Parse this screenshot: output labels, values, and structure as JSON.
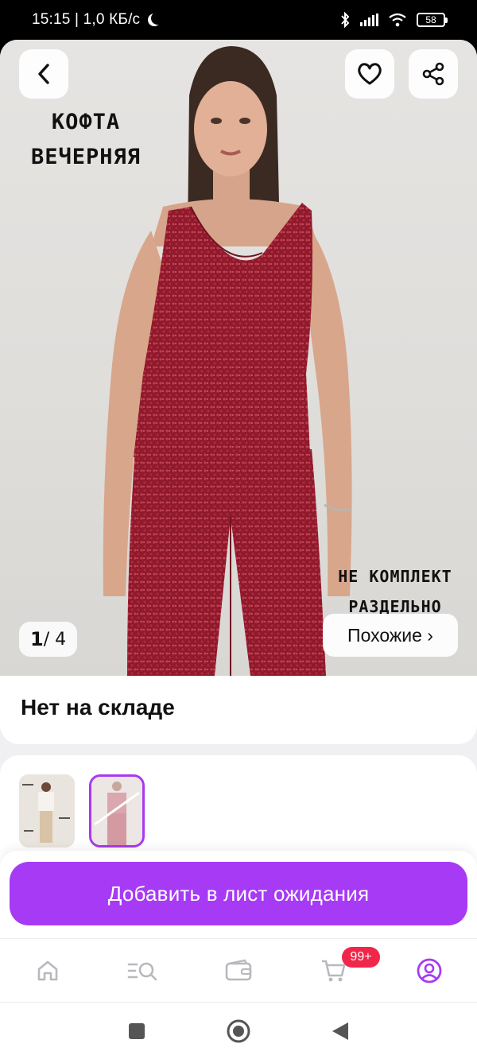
{
  "status_bar": {
    "time": "15:15",
    "speed": "| 1,0 КБ/с",
    "battery": "58"
  },
  "product": {
    "overlay_title_line1": "КОФТА",
    "overlay_title_line2": "ВЕЧЕРНЯЯ",
    "overlay_note_line1": "НЕ КОМПЛЕКТ",
    "overlay_note_line2": "РАЗДЕЛЬНО",
    "image_counter_current": "1",
    "image_counter_total": "/ 4",
    "similar_label": "Похожие ›",
    "stock_status": "Нет на складе"
  },
  "cta": {
    "label": "Добавить в лист ожидания",
    "color": "#a73af5"
  },
  "tabbar": {
    "items": [
      {
        "icon": "home-icon"
      },
      {
        "icon": "catalog-search-icon"
      },
      {
        "icon": "wallet-icon"
      },
      {
        "icon": "cart-icon",
        "badge": "99+"
      },
      {
        "icon": "profile-icon",
        "active": true
      }
    ]
  },
  "colors": {
    "accent": "#a73af5",
    "badge": "#f0264a",
    "garment": "#9b1c2e"
  }
}
